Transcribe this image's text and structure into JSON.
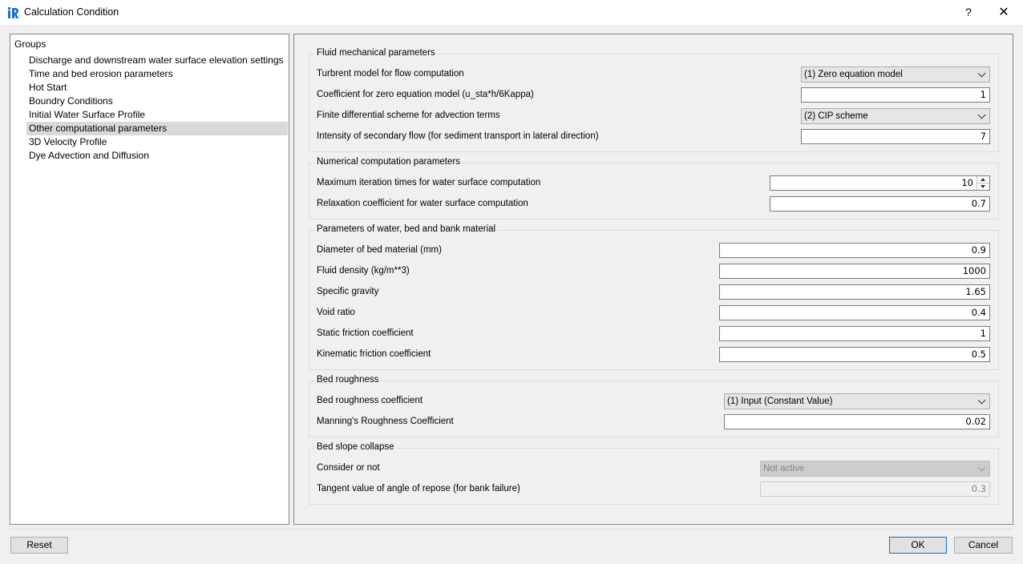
{
  "window": {
    "title": "Calculation Condition",
    "help_label": "?",
    "close_label": "✕"
  },
  "groups": {
    "header": "Groups",
    "items": [
      {
        "label": "Discharge and downstream water surface elevation settings"
      },
      {
        "label": "Time and bed erosion parameters"
      },
      {
        "label": "Hot Start"
      },
      {
        "label": "Boundry Conditions"
      },
      {
        "label": "Initial Water Surface Profile"
      },
      {
        "label": "Other computational parameters",
        "selected": true
      },
      {
        "label": "3D Velocity Profile"
      },
      {
        "label": "Dye Advection and Diffusion"
      }
    ]
  },
  "fluid": {
    "title": "Fluid mechanical parameters",
    "turb_label": "Turbrent model for flow computation",
    "turb_value": "(1) Zero equation model",
    "coef_label": "Coefficient for zero equation model (u_sta*h/6Kappa)",
    "coef_value": "1",
    "scheme_label": "Finite differential scheme for advection terms",
    "scheme_value": "(2) CIP scheme",
    "secondary_label": "Intensity of secondary flow (for sediment transport in lateral direction)",
    "secondary_value": "7"
  },
  "numerical": {
    "title": "Numerical computation parameters",
    "iter_label": "Maximum iteration times for water surface computation",
    "iter_value": "10",
    "relax_label": "Relaxation coefficient for water surface computation",
    "relax_value": "0.7"
  },
  "material": {
    "title": "Parameters of water, bed and bank material",
    "diameter_label": "Diameter of bed material (mm)",
    "diameter_value": "0.9",
    "density_label": "Fluid density (kg/m**3)",
    "density_value": "1000",
    "gravity_label": "Specific gravity",
    "gravity_value": "1.65",
    "void_label": "Void ratio",
    "void_value": "0.4",
    "static_label": "Static friction coefficient",
    "static_value": "1",
    "kinematic_label": "Kinematic friction coefficient",
    "kinematic_value": "0.5"
  },
  "roughness": {
    "title": "Bed roughness",
    "coef_label": "Bed roughness coefficient",
    "coef_value": "(1) Input (Constant Value)",
    "manning_label": "Manning's Roughness Coefficient",
    "manning_value": "0.02"
  },
  "collapse": {
    "title": "Bed slope collapse",
    "consider_label": "Consider or not",
    "consider_value": "Not active",
    "tangent_label": "Tangent value of angle of repose (for bank failure)",
    "tangent_value": "0.3"
  },
  "buttons": {
    "reset": "Reset",
    "ok": "OK",
    "cancel": "Cancel"
  }
}
